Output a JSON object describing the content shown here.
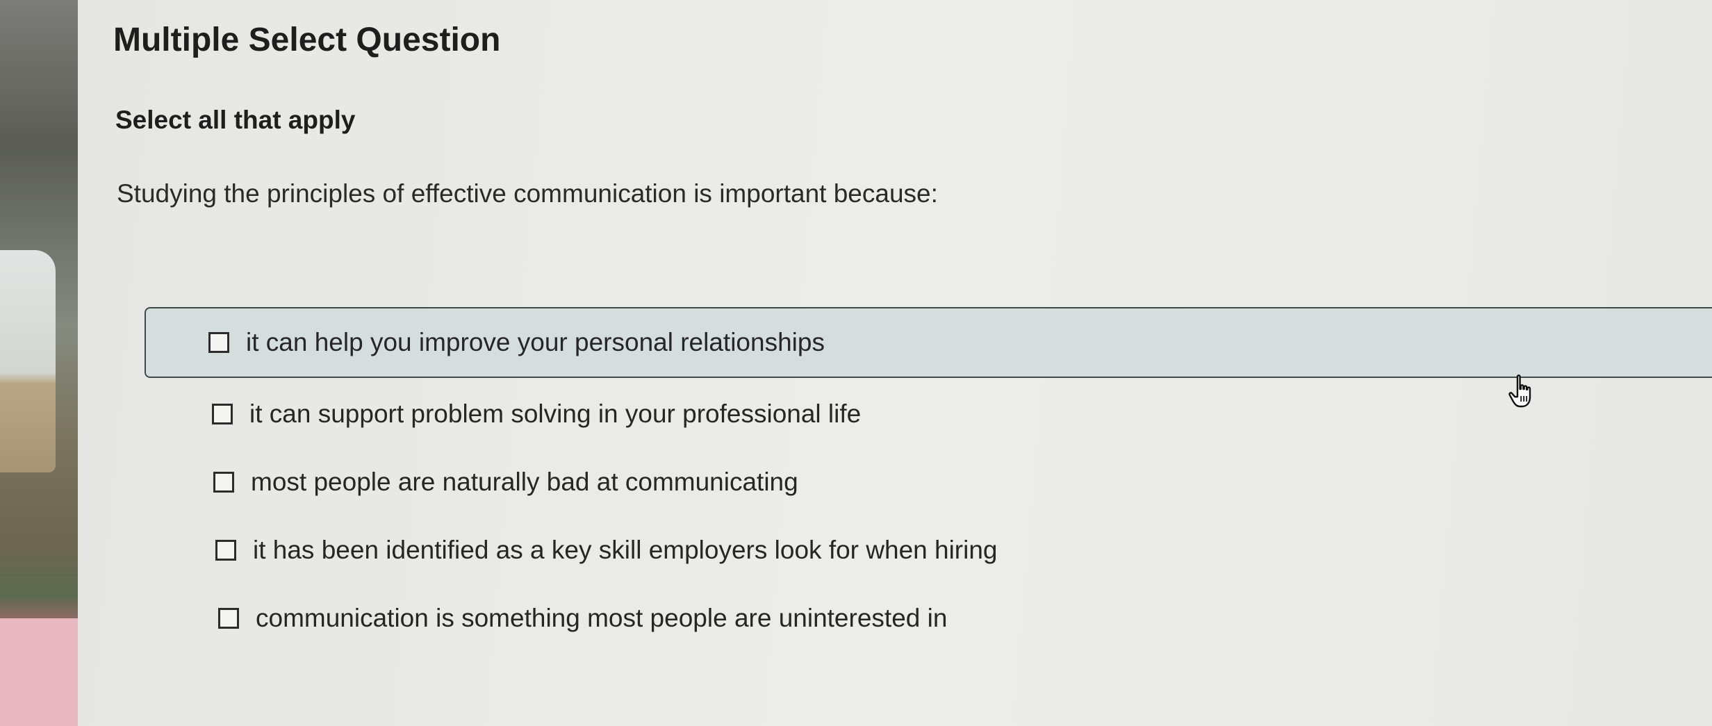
{
  "question": {
    "type_label": "Multiple Select Question",
    "instruction": "Select all that apply",
    "prompt": "Studying the principles of effective communication is important because:",
    "options": [
      {
        "label": "it can help you improve your personal relationships",
        "checked": false,
        "highlighted": true
      },
      {
        "label": "it can support problem solving in your professional life",
        "checked": false,
        "highlighted": false
      },
      {
        "label": "most people are naturally bad at communicating",
        "checked": false,
        "highlighted": false
      },
      {
        "label": "it has been identified as a key skill employers look for when hiring",
        "checked": false,
        "highlighted": false
      },
      {
        "label": "communication is something most people are uninterested in",
        "checked": false,
        "highlighted": false
      }
    ]
  },
  "cursor": {
    "icon": "hand-pointer-icon"
  },
  "colors": {
    "highlight_bg": "#d5dedd",
    "highlight_border": "#3e4a48",
    "text": "#262626"
  }
}
